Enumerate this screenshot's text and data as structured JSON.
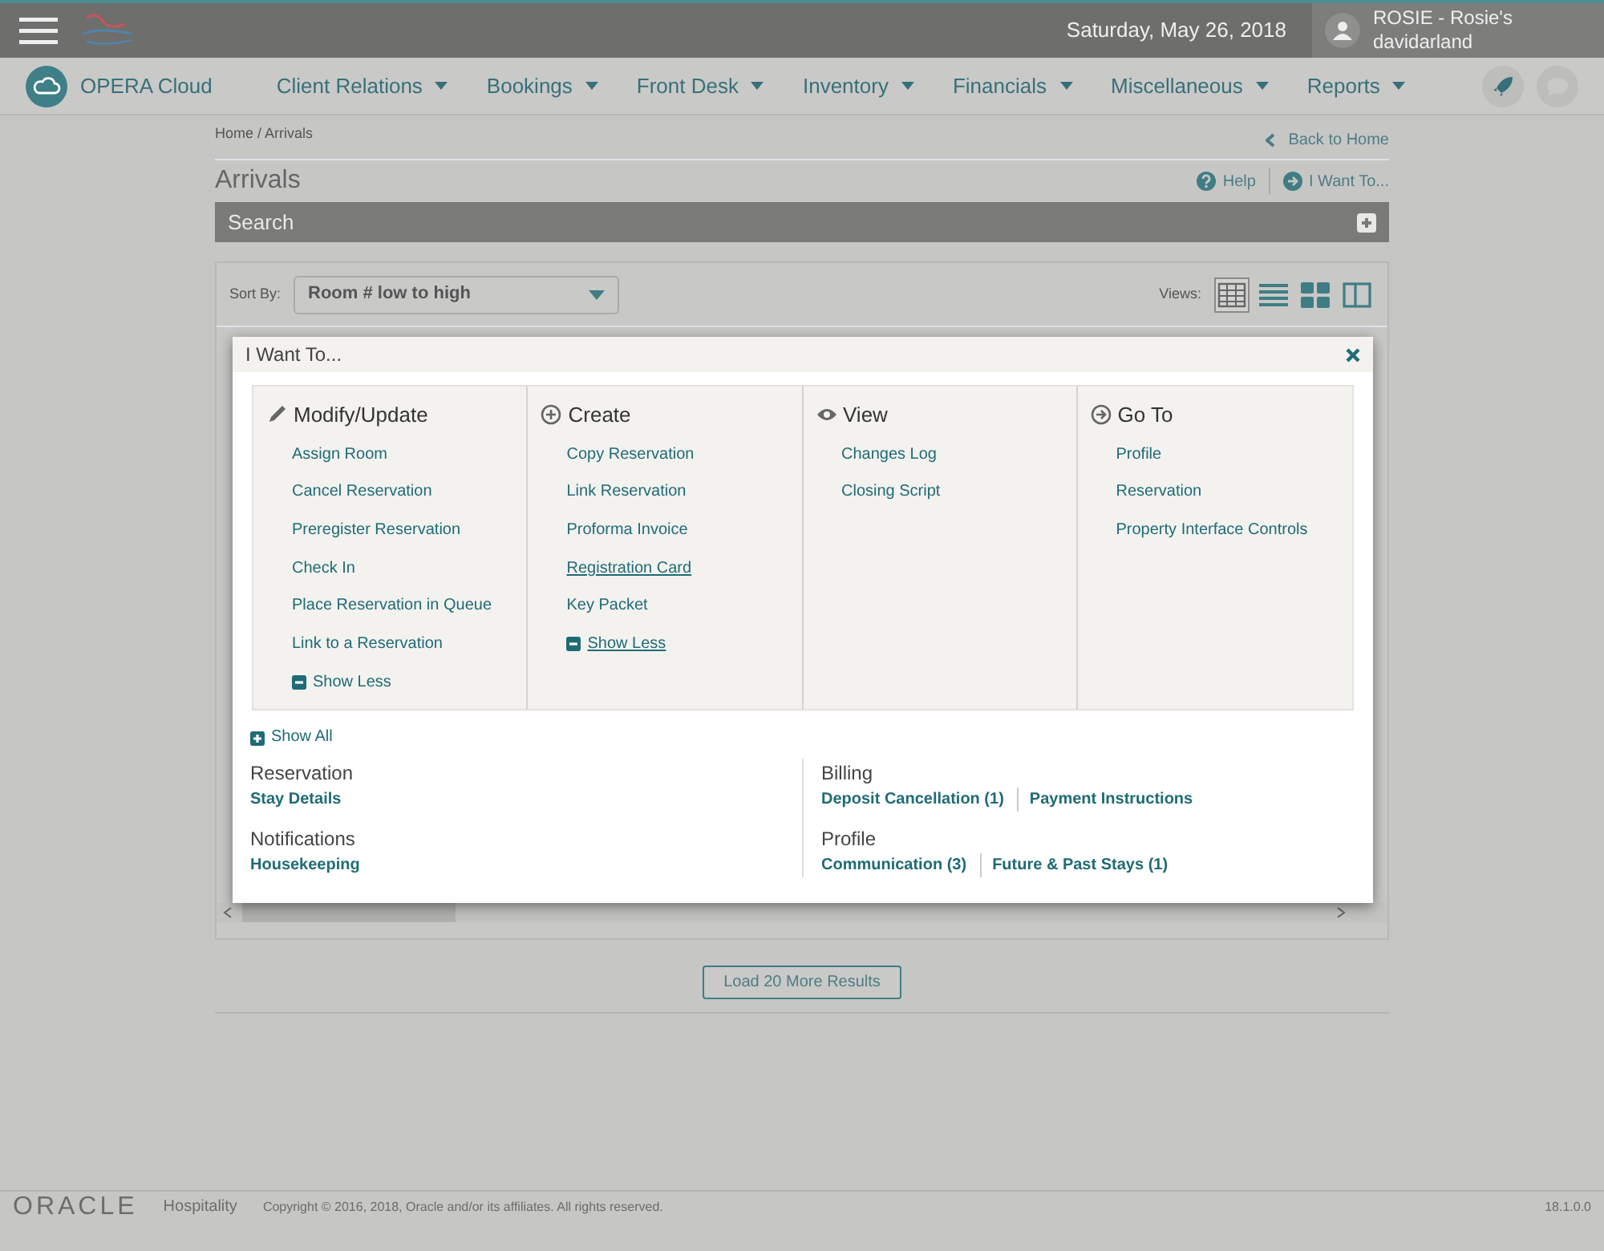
{
  "header": {
    "date": "Saturday, May 26, 2018",
    "user_name": "ROSIE - Rosie's",
    "user_login": "davidarland"
  },
  "nav": {
    "brand": "OPERA Cloud",
    "menus": [
      "Client Relations",
      "Bookings",
      "Front Desk",
      "Inventory",
      "Financials",
      "Miscellaneous",
      "Reports"
    ]
  },
  "breadcrumb": "Home / Arrivals",
  "back_link": "Back to Home",
  "title": "Arrivals",
  "help": "Help",
  "i_want_to": "I Want To...",
  "search_panel": {
    "title": "Search"
  },
  "sort": {
    "label": "Sort By:",
    "value": "Room # low to high"
  },
  "views": {
    "label": "Views:",
    "options": [
      {
        "kind": "table",
        "selected": true
      },
      {
        "kind": "list",
        "selected": false
      },
      {
        "kind": "tiles",
        "selected": false
      },
      {
        "kind": "split",
        "selected": false
      }
    ]
  },
  "dialog": {
    "title": "I Want To...",
    "columns": [
      {
        "kind": "edit",
        "heading": "Modify/Update",
        "items": [
          {
            "label": "Assign Room",
            "hovered": false
          },
          {
            "label": "Cancel Reservation",
            "hovered": false
          },
          {
            "label": "Preregister Reservation",
            "hovered": false
          },
          {
            "label": "Check In",
            "hovered": false
          },
          {
            "label": "Place Reservation in Queue",
            "hovered": false
          },
          {
            "label": "Link to a Reservation",
            "hovered": false
          }
        ],
        "toggle": {
          "label": "Show Less",
          "hovered": false
        }
      },
      {
        "kind": "create",
        "heading": "Create",
        "items": [
          {
            "label": "Copy Reservation",
            "hovered": false
          },
          {
            "label": "Link Reservation",
            "hovered": false
          },
          {
            "label": "Proforma Invoice",
            "hovered": false
          },
          {
            "label": "Registration Card",
            "hovered": true
          },
          {
            "label": "Key Packet",
            "hovered": false
          }
        ],
        "toggle": {
          "label": "Show Less",
          "hovered": true
        }
      },
      {
        "kind": "view",
        "heading": "View",
        "items": [
          {
            "label": "Changes Log",
            "hovered": false
          },
          {
            "label": "Closing Script",
            "hovered": false
          }
        ]
      },
      {
        "kind": "goto",
        "heading": "Go To",
        "items": [
          {
            "label": "Profile",
            "hovered": false
          },
          {
            "label": "Reservation",
            "hovered": false
          },
          {
            "label": "Property Interface Controls",
            "hovered": false
          }
        ]
      }
    ],
    "show_all": "Show All",
    "summary": [
      [
        {
          "title": "Reservation",
          "links": [
            "Stay Details"
          ]
        },
        {
          "title": "Notifications",
          "links": [
            "Housekeeping"
          ]
        }
      ],
      [
        {
          "title": "Billing",
          "links": [
            "Deposit Cancellation (1)",
            "Payment Instructions"
          ]
        },
        {
          "title": "Profile",
          "links": [
            "Communication (3)",
            "Future & Past Stays (1)"
          ]
        }
      ]
    ]
  },
  "load_more": "Load 20 More Results",
  "footer": {
    "logo": "ORACLE",
    "product": "Hospitality",
    "copyright": "Copyright © 2016, 2018, Oracle and/or its affiliates. All rights reserved.",
    "version": "18.1.0.0"
  }
}
